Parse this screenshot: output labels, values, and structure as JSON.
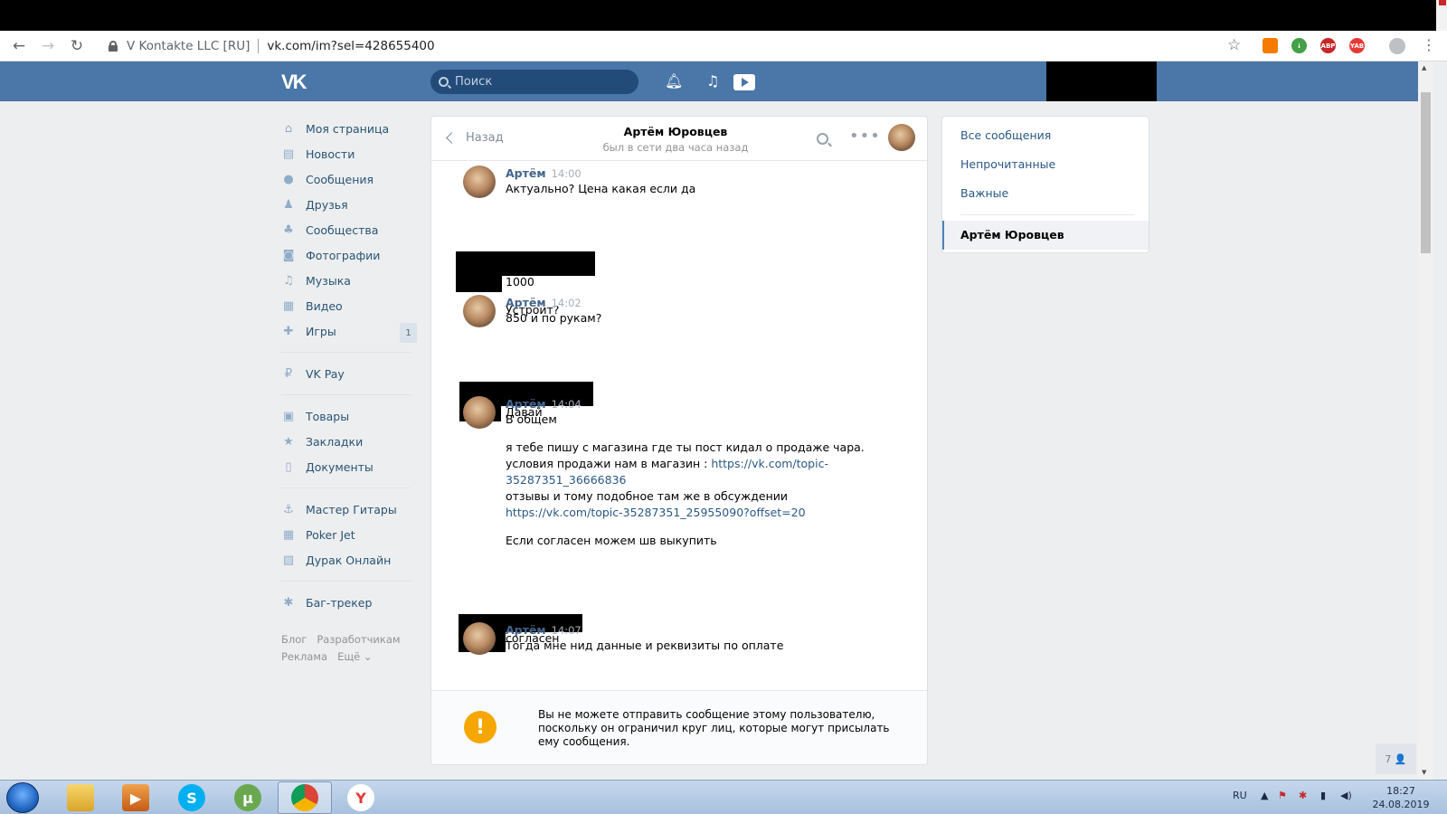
{
  "browser": {
    "company": "V Kontakte LLC [RU]",
    "url": "vk.com/im?sel=428655400",
    "extensions": [
      {
        "name": "flash-extension-icon",
        "label": "",
        "color": "#f57c00"
      },
      {
        "name": "download-extension-icon",
        "label": "",
        "color": "#43a047"
      },
      {
        "name": "adblock-extension-icon",
        "label": "ABP",
        "color": "#c62828"
      },
      {
        "name": "yandex-extension-icon",
        "label": "YAB",
        "color": "#e53935"
      }
    ]
  },
  "vk": {
    "logo": "VK",
    "search_placeholder": "Поиск",
    "accent": "#4a76a8"
  },
  "nav": {
    "items": [
      {
        "label": "Моя страница",
        "icon": "home-icon",
        "glyph": "⌂"
      },
      {
        "label": "Новости",
        "icon": "news-icon",
        "glyph": "▤"
      },
      {
        "label": "Сообщения",
        "icon": "messages-icon",
        "glyph": "●"
      },
      {
        "label": "Друзья",
        "icon": "friends-icon",
        "glyph": "♟"
      },
      {
        "label": "Сообщества",
        "icon": "communities-icon",
        "glyph": "♣"
      },
      {
        "label": "Фотографии",
        "icon": "photos-icon",
        "glyph": "◙"
      },
      {
        "label": "Музыка",
        "icon": "music-icon",
        "glyph": "♫"
      },
      {
        "label": "Видео",
        "icon": "video-icon",
        "glyph": "▦"
      },
      {
        "label": "Игры",
        "icon": "games-icon",
        "glyph": "✚",
        "badge": "1"
      }
    ],
    "pay": {
      "label": "VK Pay",
      "icon": "vkpay-icon",
      "glyph": "₽"
    },
    "items2": [
      {
        "label": "Товары",
        "icon": "goods-icon",
        "glyph": "▣"
      },
      {
        "label": "Закладки",
        "icon": "bookmarks-icon",
        "glyph": "★"
      },
      {
        "label": "Документы",
        "icon": "documents-icon",
        "glyph": "▯"
      }
    ],
    "apps": [
      {
        "label": "Мастер Гитары",
        "icon": "app-guitar-icon",
        "glyph": "⚓"
      },
      {
        "label": "Poker Jet",
        "icon": "app-poker-icon",
        "glyph": "▦"
      },
      {
        "label": "Дурак Онлайн",
        "icon": "app-durak-icon",
        "glyph": "▨"
      }
    ],
    "bugtracker": {
      "label": "Баг-трекер",
      "icon": "bug-icon",
      "glyph": "✱"
    },
    "footer": {
      "blog": "Блог",
      "dev": "Разработчикам",
      "ads": "Реклама",
      "more": "Ещё ⌄"
    }
  },
  "chat": {
    "back": "Назад",
    "peer_name": "Артём Юровцев",
    "peer_status": "был в сети два часа назад",
    "messages": [
      {
        "author": "Артём",
        "time": "14:00",
        "lines": [
          "Актуально? Цена какая если да"
        ]
      },
      {
        "lines": [
          "1000",
          "Устроит?"
        ]
      },
      {
        "author": "Артём",
        "time": "14:02",
        "lines": [
          "850 и по рукам?"
        ]
      },
      {
        "lines": [
          "Давай"
        ]
      },
      {
        "author": "Артём",
        "time": "14:04",
        "lines": [
          "В общем",
          "я тебе пишу с магазина где ты пост кидал о продаже чара.",
          "условия продажи нам в магазин : ",
          "https://vk.com/topic-",
          "35287351_36666836",
          "отзывы и тому подобное там же в обсуждении",
          "https://vk.com/topic-35287351_25955090?offset=20",
          "Если согласен можем шв выкупить"
        ]
      },
      {
        "lines": [
          "согласен"
        ]
      },
      {
        "author": "Артём",
        "time": "14:07",
        "lines": [
          "Тогда мне нид данные и реквизиты по оплате"
        ]
      }
    ],
    "blocked_notice": "Вы не можете отправить сообщение этому пользователю, поскольку он ограничил круг лиц, которые могут присылать ему сообщения.",
    "warn_glyph": "!"
  },
  "right": {
    "all": "Все сообщения",
    "unread": "Непрочитанные",
    "important": "Важные",
    "active": "Артём Юровцев"
  },
  "online_widget": "7 👤",
  "taskbar": {
    "lang": "RU",
    "time": "18:27",
    "date": "24.08.2019"
  }
}
